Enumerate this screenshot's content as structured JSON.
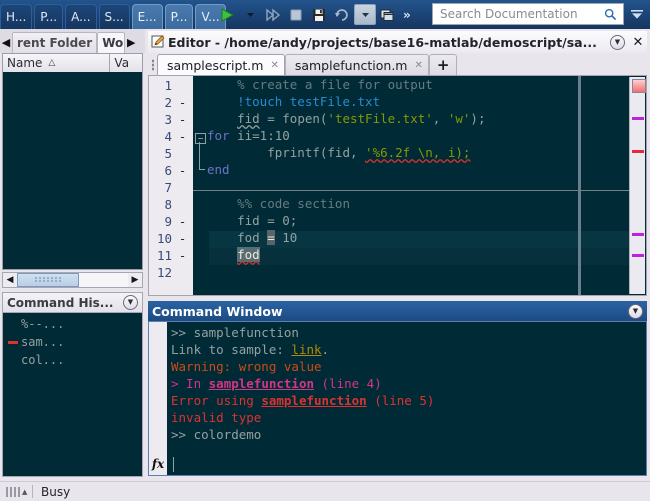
{
  "ribbon": {
    "tabs": [
      {
        "label": "H...",
        "style": "dark"
      },
      {
        "label": "P...",
        "style": "dark"
      },
      {
        "label": "A...",
        "style": "dark"
      },
      {
        "label": "S...",
        "style": "dark"
      },
      {
        "label": "E...",
        "style": "light"
      },
      {
        "label": "P...",
        "style": "light"
      },
      {
        "label": "V...",
        "style": "light"
      }
    ],
    "toolbar": {
      "run": "run-icon",
      "run_dropdown": "caret-down-icon",
      "run_advance": "run-and-advance-icon",
      "stop": "stop-icon",
      "save": "save-icon",
      "undo": "undo-icon",
      "undo_dropdown": "caret-down-icon",
      "layout": "window-layout-icon",
      "overflow": "»"
    },
    "search": {
      "placeholder": "Search Documentation",
      "icon": "search-icon"
    },
    "expand": "chevron-down-icon"
  },
  "left_panel": {
    "tabs": [
      {
        "label": "rent Folder",
        "active": false
      },
      {
        "label": "Wo",
        "active": true
      }
    ],
    "nav_prev": "◀",
    "nav_next": "▶",
    "workspace": {
      "columns": [
        {
          "label": "Name",
          "sort": "△"
        },
        {
          "label": "Va"
        }
      ],
      "rows": []
    },
    "scrollbar": {
      "left": "◀",
      "right": "▶"
    }
  },
  "command_history": {
    "title": "Command His...",
    "collapse_icon": "chevron-down-circle-icon",
    "entries": [
      {
        "text": "%--...",
        "error": false
      },
      {
        "text": "sam...",
        "error": true
      },
      {
        "text": "col...",
        "error": false
      }
    ]
  },
  "editor": {
    "title": "Editor - /home/andy/projects/base16-matlab/demoscript/sa...",
    "icon": "editor-pencil-icon",
    "dock_icon": "chevron-down-circle-icon",
    "close_icon": "✕",
    "tabs": [
      {
        "label": "samplescript.m",
        "active": true,
        "close": "✕"
      },
      {
        "label": "samplefunction.m",
        "active": false,
        "close": "✕"
      }
    ],
    "new_tab": "+",
    "lines": [
      {
        "num": "1",
        "exec": false
      },
      {
        "num": "2",
        "exec": true
      },
      {
        "num": "3",
        "exec": true
      },
      {
        "num": "4",
        "exec": true
      },
      {
        "num": "5",
        "exec": false
      },
      {
        "num": "6",
        "exec": true
      },
      {
        "num": "7",
        "exec": false
      },
      {
        "num": "8",
        "exec": false
      },
      {
        "num": "9",
        "exec": true
      },
      {
        "num": "10",
        "exec": true
      },
      {
        "num": "11",
        "exec": true
      },
      {
        "num": "12",
        "exec": false
      }
    ],
    "code_text": [
      "    % create a file for output",
      "    !touch testFile.txt",
      "    fid = fopen('testFile.txt', 'w');",
      "for ii=1:10",
      "        fprintf(fid, '%6.2f \\n, i);",
      "end",
      "",
      "    %% code section",
      "    fid = 0;",
      "    fod = 10",
      "    fod",
      ""
    ],
    "exec_dash": "-",
    "fold_glyph": "−",
    "markers": {
      "status_color": "#f07070",
      "tick_magenta": "#c020e0",
      "tick_red": "#e8283c"
    }
  },
  "command_window": {
    "title": "Command Window",
    "dock_icon": "chevron-down-circle-icon",
    "lines": [
      {
        "type": "prompt",
        "text": ">> samplefunction"
      },
      {
        "type": "link",
        "pre": "Link to sample: ",
        "link": "link",
        "post": "."
      },
      {
        "type": "warn",
        "text": "Warning: wrong value"
      },
      {
        "type": "stack",
        "pre": "> In ",
        "fn": "samplefunction",
        "post": " (line 4)"
      },
      {
        "type": "error",
        "pre": "Error using ",
        "fn": "samplefunction",
        "post": " (line 5)"
      },
      {
        "type": "error_plain",
        "text": "invalid type"
      },
      {
        "type": "prompt",
        "text": ">> colordemo"
      }
    ],
    "fx_label": "fx",
    "fx_caret": "▾"
  },
  "status_bar": {
    "text": "Busy",
    "grip": "resize-grip-icon"
  }
}
